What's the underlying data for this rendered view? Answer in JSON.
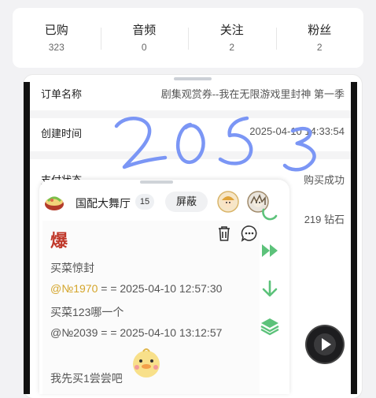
{
  "stats": [
    {
      "label": "已购",
      "value": "323"
    },
    {
      "label": "音频",
      "value": "0"
    },
    {
      "label": "关注",
      "value": "2"
    },
    {
      "label": "粉丝",
      "value": "2"
    }
  ],
  "order": {
    "name_label": "订单名称",
    "name_value": "剧集观赏券--我在无限游戏里封神 第一季",
    "created_label": "创建时间",
    "created_value": "2025-04-10 14:33:54",
    "status_label": "支付状态",
    "status_value": "购买成功",
    "amount_value": "219 钻石"
  },
  "chat": {
    "room_name": "国配大舞厅",
    "room_count": "15",
    "block_label": "屏蔽",
    "banner_text": "爆",
    "messages": [
      {
        "text": "买菜惊封"
      },
      {
        "mention": "@№1970",
        "rest": " = = 2025-04-10 12:57:30"
      },
      {
        "text": "买菜123哪一个"
      },
      {
        "text": "@№2039 = = 2025-04-10 13:12:57"
      },
      {
        "text": "我先买1尝尝吧"
      }
    ]
  },
  "colors": {
    "accent_green": "#5cc27a",
    "mention": "#d4a52a",
    "scribble": "#7b96f5"
  }
}
